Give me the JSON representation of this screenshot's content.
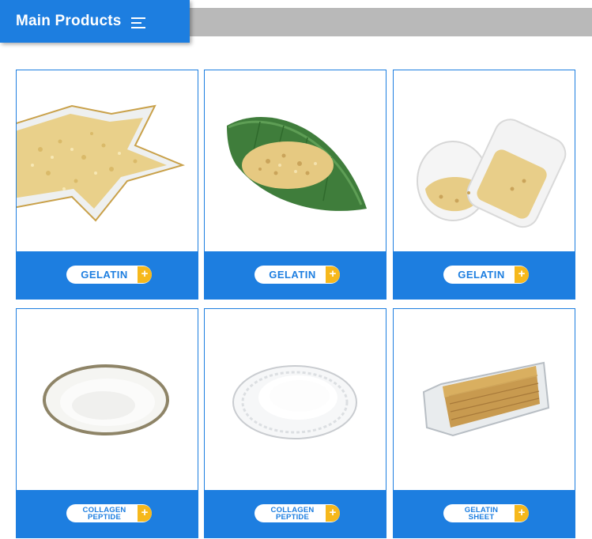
{
  "header": {
    "title": "Main Products"
  },
  "products": [
    {
      "lines": [
        "GELATIN"
      ],
      "image": "gelatin-granules-star-dish"
    },
    {
      "lines": [
        "GELATIN"
      ],
      "image": "gelatin-granules-leaf-dish"
    },
    {
      "lines": [
        "GELATIN"
      ],
      "image": "gelatin-granules-glass-jar"
    },
    {
      "lines": [
        "COLLAGEN",
        "PEPTIDE"
      ],
      "image": "collagen-powder-ceramic-dish"
    },
    {
      "lines": [
        "COLLAGEN",
        "PEPTIDE"
      ],
      "image": "collagen-powder-glass-plate"
    },
    {
      "lines": [
        "GELATIN",
        "SHEET"
      ],
      "image": "gelatin-sheets-packaged"
    }
  ],
  "colors": {
    "accent": "#1d7ee0",
    "plus": "#f6b81c",
    "bar": "#b9b9b9"
  },
  "icons": {
    "menu": "menu-icon",
    "more": "plus-icon"
  }
}
